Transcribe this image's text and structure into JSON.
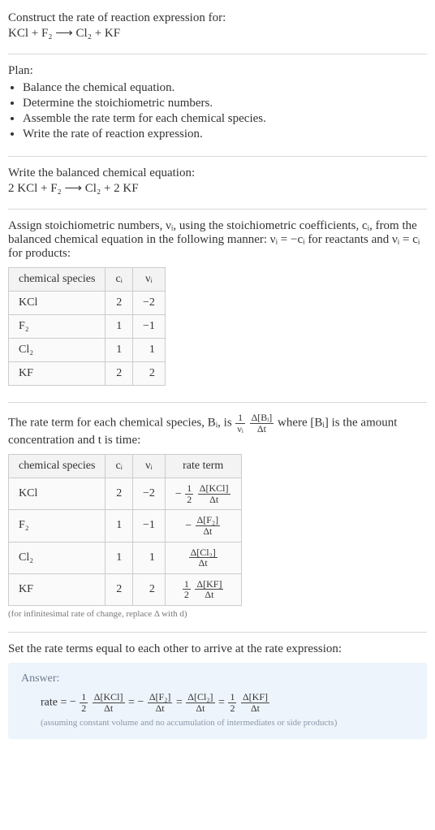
{
  "intro": {
    "title": "Construct the rate of reaction expression for:",
    "equation": "KCl + F₂  ⟶  Cl₂ + KF"
  },
  "plan": {
    "heading": "Plan:",
    "items": [
      "Balance the chemical equation.",
      "Determine the stoichiometric numbers.",
      "Assemble the rate term for each chemical species.",
      "Write the rate of reaction expression."
    ]
  },
  "balanced": {
    "heading": "Write the balanced chemical equation:",
    "equation": "2 KCl + F₂  ⟶  Cl₂ + 2 KF"
  },
  "stoich": {
    "heading": "Assign stoichiometric numbers, νᵢ, using the stoichiometric coefficients, cᵢ, from the balanced chemical equation in the following manner: νᵢ = −cᵢ for reactants and νᵢ = cᵢ for products:",
    "cols": [
      "chemical species",
      "cᵢ",
      "νᵢ"
    ],
    "rows": [
      {
        "species": "KCl",
        "c": "2",
        "v": "−2"
      },
      {
        "species": "F₂",
        "c": "1",
        "v": "−1"
      },
      {
        "species": "Cl₂",
        "c": "1",
        "v": "1"
      },
      {
        "species": "KF",
        "c": "2",
        "v": "2"
      }
    ]
  },
  "rateterm": {
    "heading_pre": "The rate term for each chemical species, Bᵢ, is ",
    "heading_frac_num": "1",
    "heading_frac_den": "νᵢ",
    "heading_frac2_num": "Δ[Bᵢ]",
    "heading_frac2_den": "Δt",
    "heading_post": " where [Bᵢ] is the amount concentration and t is time:",
    "cols": [
      "chemical species",
      "cᵢ",
      "νᵢ",
      "rate term"
    ],
    "rows": [
      {
        "species": "KCl",
        "c": "2",
        "v": "−2",
        "term_prefix": "−",
        "term_coef_num": "1",
        "term_coef_den": "2",
        "term_num": "Δ[KCl]",
        "term_den": "Δt"
      },
      {
        "species": "F₂",
        "c": "1",
        "v": "−1",
        "term_prefix": "−",
        "term_coef_num": "",
        "term_coef_den": "",
        "term_num": "Δ[F₂]",
        "term_den": "Δt"
      },
      {
        "species": "Cl₂",
        "c": "1",
        "v": "1",
        "term_prefix": "",
        "term_coef_num": "",
        "term_coef_den": "",
        "term_num": "Δ[Cl₂]",
        "term_den": "Δt"
      },
      {
        "species": "KF",
        "c": "2",
        "v": "2",
        "term_prefix": "",
        "term_coef_num": "1",
        "term_coef_den": "2",
        "term_num": "Δ[KF]",
        "term_den": "Δt"
      }
    ],
    "note": "(for infinitesimal rate of change, replace Δ with d)"
  },
  "final": {
    "heading": "Set the rate terms equal to each other to arrive at the rate expression:"
  },
  "answer": {
    "label": "Answer:",
    "prefix": "rate = ",
    "terms": [
      {
        "prefix": "−",
        "coef_num": "1",
        "coef_den": "2",
        "num": "Δ[KCl]",
        "den": "Δt"
      },
      {
        "prefix": "−",
        "coef_num": "",
        "coef_den": "",
        "num": "Δ[F₂]",
        "den": "Δt"
      },
      {
        "prefix": "",
        "coef_num": "",
        "coef_den": "",
        "num": "Δ[Cl₂]",
        "den": "Δt"
      },
      {
        "prefix": "",
        "coef_num": "1",
        "coef_den": "2",
        "num": "Δ[KF]",
        "den": "Δt"
      }
    ],
    "assumption": "(assuming constant volume and no accumulation of intermediates or side products)"
  },
  "chart_data": {
    "type": "table",
    "title": "Stoichiometric numbers and rate terms for 2 KCl + F₂ ⟶ Cl₂ + 2 KF",
    "species": [
      "KCl",
      "F₂",
      "Cl₂",
      "KF"
    ],
    "c_i": [
      2,
      1,
      1,
      2
    ],
    "nu_i": [
      -2,
      -1,
      1,
      2
    ],
    "rate_terms": [
      "-(1/2) Δ[KCl]/Δt",
      "-Δ[F₂]/Δt",
      "Δ[Cl₂]/Δt",
      "(1/2) Δ[KF]/Δt"
    ],
    "rate_expression": "rate = -(1/2) Δ[KCl]/Δt = -Δ[F₂]/Δt = Δ[Cl₂]/Δt = (1/2) Δ[KF]/Δt"
  }
}
